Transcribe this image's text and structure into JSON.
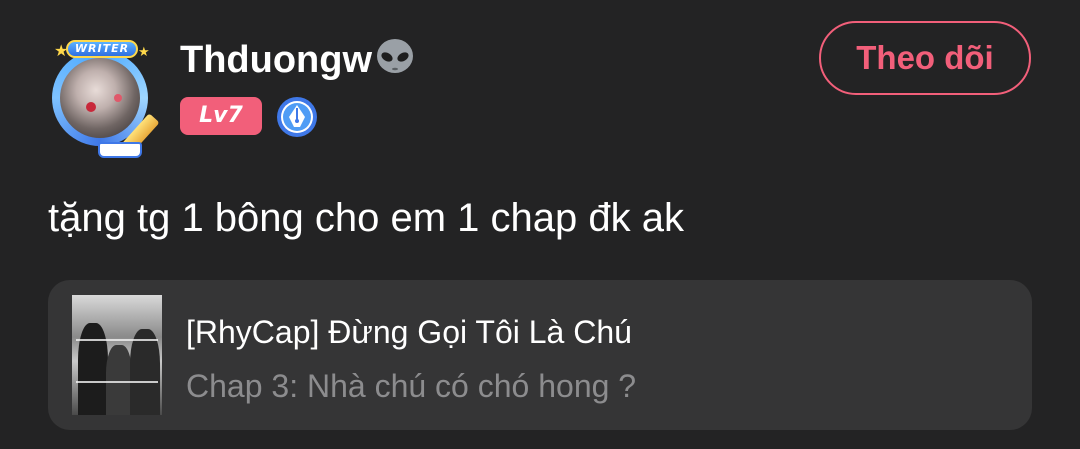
{
  "user": {
    "name": "Thduongw",
    "name_icon": "alien-emoji-icon",
    "level": "Lv7",
    "avatar_badge": "WRITER",
    "writer_pen_badge": "fountain-pen-badge-icon"
  },
  "follow_button": {
    "label": "Theo dõi"
  },
  "comment": {
    "text": "tặng tg 1 bông cho em 1 chap đk ak"
  },
  "story": {
    "title": "[RhyCap] Đừng Gọi Tôi Là Chú",
    "chapter": "Chap 3: Nhà chú có chó hong ?",
    "cover_icon": "story-cover-image"
  },
  "colors": {
    "background": "#232324",
    "card": "#353536",
    "accent": "#f25f7a",
    "muted_text": "#8c8c8e",
    "badge_blue": "#3f78e8"
  }
}
